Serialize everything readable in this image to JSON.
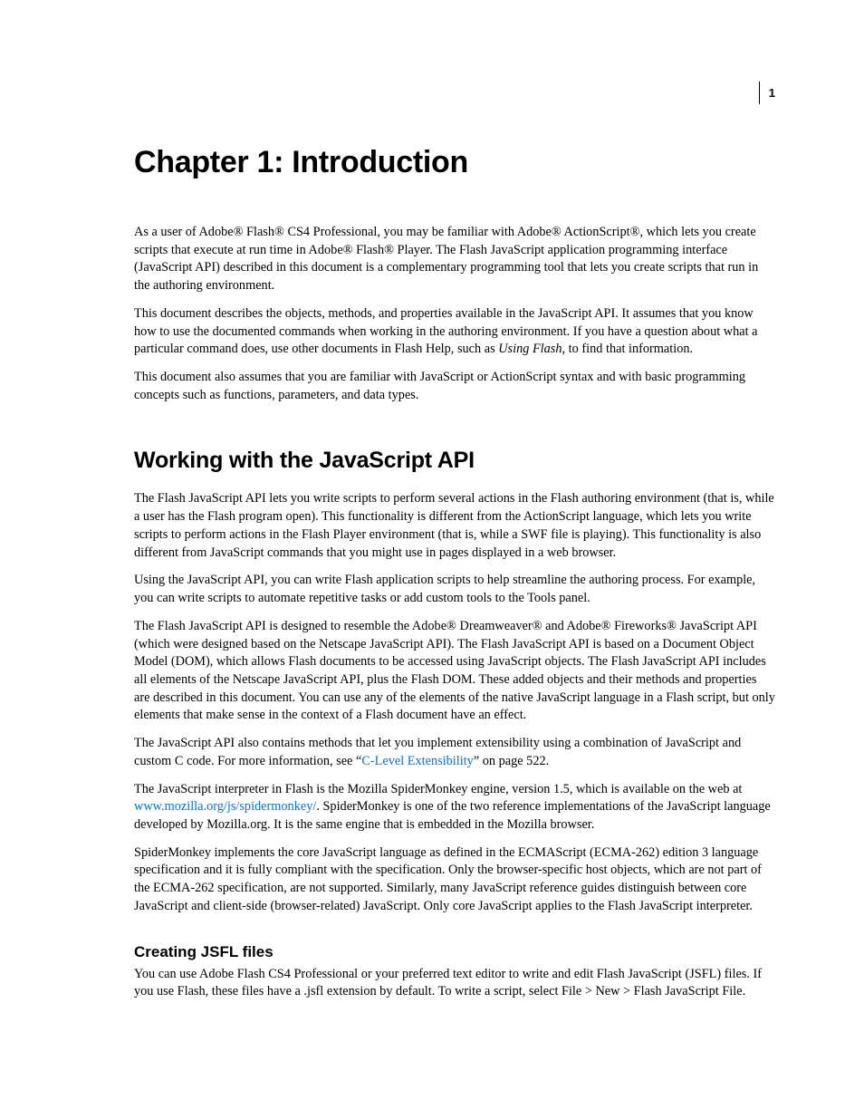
{
  "page_number": "1",
  "chapter_title": "Chapter 1: Introduction",
  "intro": {
    "p1a": "As a user of Adobe® Flash® CS4 Professional, you may be familiar with Adobe®  ActionScript®, which lets you create scripts that execute at run time in Adobe® Flash® Player. The Flash JavaScript application programming interface (JavaScript API) described in this document is a complementary programming tool that lets you create scripts that run in the authoring environment.",
    "p2a": "This document describes the objects, methods, and properties available in the JavaScript API. It assumes that you know how to use the documented commands when working in the authoring environment. If you have a question about what a particular command does, use other documents in Flash Help, such as ",
    "p2_em": "Using Flash",
    "p2b": ", to find that information.",
    "p3": "This document also assumes that you are familiar with JavaScript or ActionScript syntax and with basic programming concepts such as functions, parameters, and data types."
  },
  "section1": {
    "title": "Working with the JavaScript API",
    "p1": "The Flash JavaScript API lets you write scripts to perform several actions in the Flash authoring environment (that is, while a user has the Flash program open). This functionality is different from the ActionScript language, which lets you write scripts to perform actions in the Flash Player environment (that is, while a SWF file is playing). This functionality is also different from JavaScript commands that you might use in pages displayed in a web browser.",
    "p2": "Using the JavaScript API, you can write Flash application scripts to help streamline the authoring process. For example, you can write scripts to automate repetitive tasks or add custom tools to the Tools panel.",
    "p3": "The Flash JavaScript API is designed to resemble the Adobe® Dreamweaver® and Adobe® Fireworks® JavaScript API (which were designed based on the Netscape JavaScript API). The Flash JavaScript API is based on a Document Object Model (DOM), which allows Flash documents to be accessed using JavaScript objects. The Flash JavaScript API includes all elements of the Netscape JavaScript API, plus the Flash DOM. These added objects and their methods and properties are described in this document. You can use any of the elements of the native JavaScript language in a Flash script, but only elements that make sense in the context of a Flash document have an effect.",
    "p4a": "The JavaScript API also contains methods that let you implement extensibility using a combination of JavaScript and custom C code. For more information, see “",
    "p4_link": "C-Level Extensibility",
    "p4b": "” on page 522.",
    "p5a": "The JavaScript interpreter in Flash is the Mozilla SpiderMonkey engine, version 1.5, which is available on the web at ",
    "p5_link": "www.mozilla.org/js/spidermonkey/",
    "p5b": ". SpiderMonkey is one of the two reference implementations of the JavaScript language developed by Mozilla.org. It is the same engine that is embedded in the Mozilla browser.",
    "p6": "SpiderMonkey implements the core JavaScript language as defined in the ECMAScript  (ECMA-262) edition 3 language specification and it is fully compliant with the specification. Only the browser-specific host objects, which are not part of the ECMA-262 specification, are not supported. Similarly, many JavaScript reference guides distinguish between core JavaScript and client-side (browser-related) JavaScript. Only core JavaScript applies to the Flash JavaScript interpreter."
  },
  "subsection1": {
    "title": "Creating JSFL files",
    "p1": "You can use Adobe Flash CS4 Professional or your preferred text editor to write and edit Flash JavaScript (JSFL) files. If you use Flash, these files have a .jsfl extension by default. To write a script, select File > New > Flash JavaScript File."
  }
}
